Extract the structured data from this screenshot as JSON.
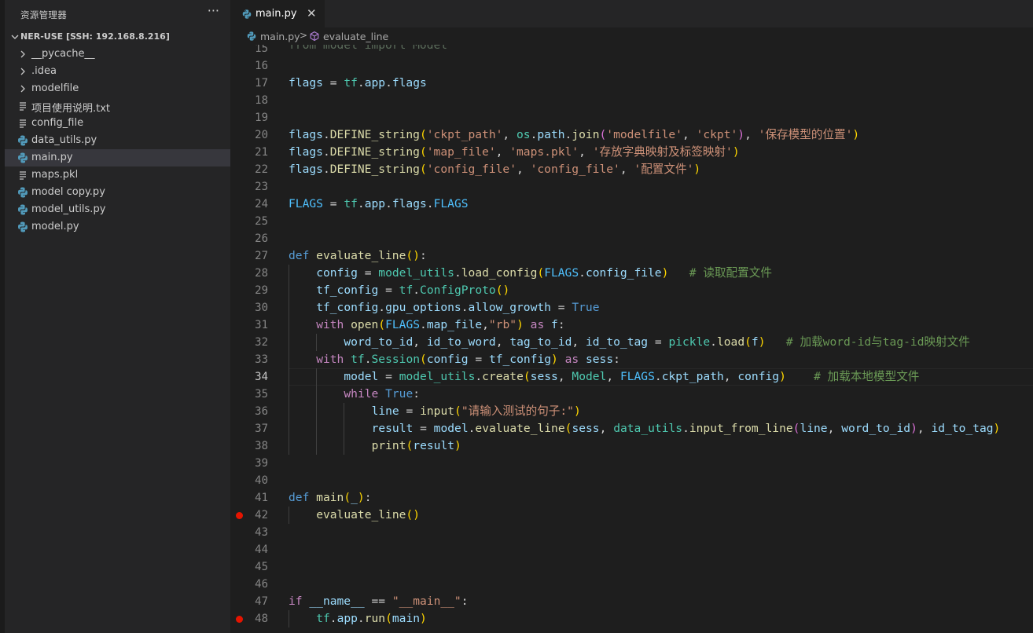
{
  "explorer": {
    "title": "资源管理器",
    "more_label": "···",
    "section_label": "NER-USE [SSH: 192.168.8.216]",
    "items": [
      {
        "label": "__pycache__",
        "kind": "folder"
      },
      {
        "label": ".idea",
        "kind": "folder"
      },
      {
        "label": "modelfile",
        "kind": "folder"
      },
      {
        "label": "项目使用说明.txt",
        "kind": "text"
      },
      {
        "label": "config_file",
        "kind": "text"
      },
      {
        "label": "data_utils.py",
        "kind": "python"
      },
      {
        "label": "main.py",
        "kind": "python",
        "selected": true
      },
      {
        "label": "maps.pkl",
        "kind": "text"
      },
      {
        "label": "model copy.py",
        "kind": "python"
      },
      {
        "label": "model_utils.py",
        "kind": "python"
      },
      {
        "label": "model.py",
        "kind": "python"
      }
    ]
  },
  "tab": {
    "label": "main.py",
    "close_label": "✕"
  },
  "breadcrumb": {
    "file": "main.py",
    "separator": ">",
    "symbol": "evaluate_line"
  },
  "editor": {
    "partial_top_line": "from model import Model",
    "current_line": 34,
    "breakpoints": [
      42,
      48
    ],
    "line_numbers": [
      "15",
      "16",
      "17",
      "18",
      "19",
      "20",
      "21",
      "22",
      "23",
      "24",
      "25",
      "26",
      "27",
      "28",
      "29",
      "30",
      "31",
      "32",
      "33",
      "34",
      "35",
      "36",
      "37",
      "38",
      "39",
      "40",
      "41",
      "42",
      "43",
      "44",
      "45",
      "46",
      "47",
      "48"
    ],
    "lines": [
      "",
      "",
      "flags = tf.app.flags",
      "",
      "",
      "flags.DEFINE_string('ckpt_path', os.path.join('modelfile', 'ckpt'), '保存模型的位置')",
      "flags.DEFINE_string('map_file', 'maps.pkl', '存放字典映射及标签映射')",
      "flags.DEFINE_string('config_file', 'config_file', '配置文件')",
      "",
      "FLAGS = tf.app.flags.FLAGS",
      "",
      "",
      "def evaluate_line():",
      "    config = model_utils.load_config(FLAGS.config_file)   # 读取配置文件",
      "    tf_config = tf.ConfigProto()",
      "    tf_config.gpu_options.allow_growth = True",
      "    with open(FLAGS.map_file,\"rb\") as f:",
      "        word_to_id, id_to_word, tag_to_id, id_to_tag = pickle.load(f)   # 加载word-id与tag-id映射文件",
      "    with tf.Session(config = tf_config) as sess:",
      "        model = model_utils.create(sess, Model, FLAGS.ckpt_path, config)    # 加载本地模型文件",
      "        while True:",
      "            line = input(\"请输入测试的句子:\")",
      "            result = model.evaluate_line(sess, data_utils.input_from_line(line, word_to_id), id_to_tag)",
      "            print(result)",
      "",
      "",
      "def main(_):",
      "    evaluate_line()",
      "",
      "",
      "",
      "",
      "if __name__ == \"__main__\":",
      "    tf.app.run(main)"
    ]
  },
  "colors": {
    "background": "#1e1e1e",
    "sidebar": "#252526",
    "selected_item": "#37373d",
    "keyword": "#569cd6",
    "control": "#c586c0",
    "variable": "#9cdcfe",
    "function": "#dcdcaa",
    "string": "#ce9178",
    "comment": "#6a9955",
    "type": "#4ec9b0",
    "breakpoint": "#e51400",
    "python_icon": "#519aba"
  }
}
